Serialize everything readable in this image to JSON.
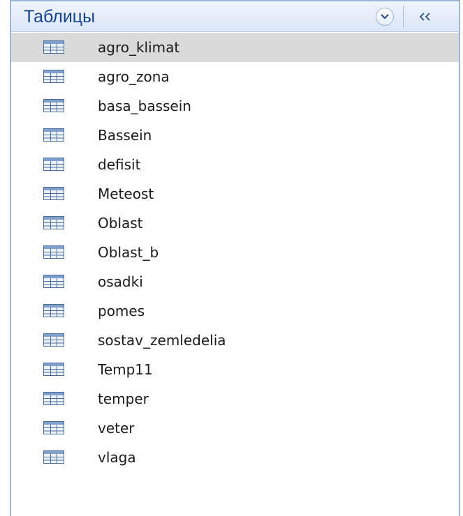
{
  "nav_pane": {
    "title": "Таблицы",
    "menu_icon": "chevron-down-circle-icon",
    "collapse_icon": "double-chevron-left-icon",
    "selected_index": 0,
    "item_icon": "table-icon",
    "items": [
      {
        "label": "agro_klimat"
      },
      {
        "label": "agro_zona"
      },
      {
        "label": "basa_bassein"
      },
      {
        "label": "Bassein"
      },
      {
        "label": "defisit"
      },
      {
        "label": "Meteost"
      },
      {
        "label": "Oblast"
      },
      {
        "label": "Oblast_b"
      },
      {
        "label": "osadki"
      },
      {
        "label": "pomes"
      },
      {
        "label": "sostav_zemledelia"
      },
      {
        "label": "Temp11"
      },
      {
        "label": "temper"
      },
      {
        "label": "veter"
      },
      {
        "label": "vlaga"
      }
    ]
  },
  "colors": {
    "header_text": "#15428b",
    "selected_bg": "#dadada",
    "border": "#9db6d6"
  }
}
